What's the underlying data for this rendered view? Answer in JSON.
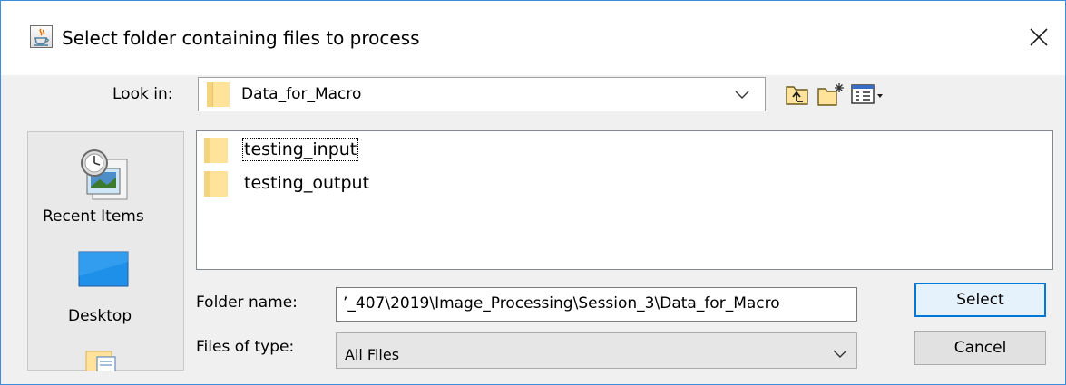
{
  "window": {
    "title": "Select folder containing files to process",
    "title_icon": "java-cup-icon",
    "close_icon": "close-icon"
  },
  "look_in": {
    "label": "Look in:",
    "value": "Data_for_Macro",
    "icon": "folder-icon"
  },
  "toolbar": {
    "icons": [
      "up-one-level-icon",
      "new-folder-icon",
      "view-menu-icon"
    ]
  },
  "places": [
    {
      "label": "Recent Items",
      "icon": "recent-items-icon"
    },
    {
      "label": "Desktop",
      "icon": "desktop-icon"
    },
    {
      "label": "",
      "icon": "documents-icon"
    }
  ],
  "files": [
    {
      "name": "testing_input",
      "icon": "folder-icon",
      "focused": true
    },
    {
      "name": "testing_output",
      "icon": "folder-icon",
      "focused": false
    }
  ],
  "folder_name": {
    "label": "Folder name:",
    "value": "’_407\\2019\\Image_Processing\\Session_3\\Data_for_Macro"
  },
  "files_of_type": {
    "label": "Files of type:",
    "value": "All Files"
  },
  "buttons": {
    "select": "Select",
    "cancel": "Cancel"
  },
  "colors": {
    "window_border": "#3c8ddc",
    "folder": "#ffe39a",
    "primary_button_border": "#0078d7",
    "dialog_background": "#f0f0f0"
  }
}
